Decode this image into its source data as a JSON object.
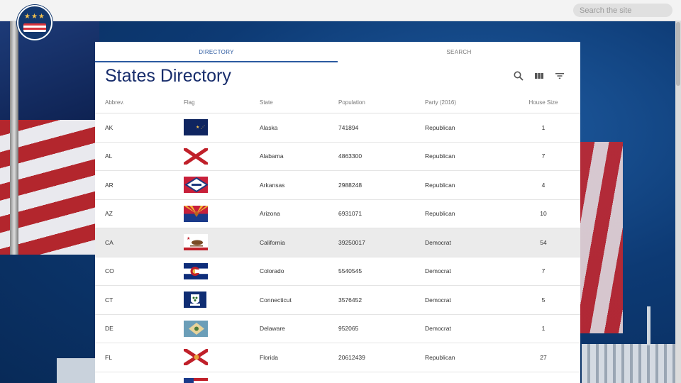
{
  "header": {
    "search_placeholder": "Search the site"
  },
  "tabs": [
    {
      "label": "DIRECTORY",
      "active": true
    },
    {
      "label": "SEARCH",
      "active": false
    }
  ],
  "page_title": "States Directory",
  "toolbar": {
    "icons": [
      "search-icon",
      "columns-icon",
      "filter-icon"
    ]
  },
  "table": {
    "columns": [
      "Abbrev.",
      "Flag",
      "State",
      "Population",
      "Party (2016)",
      "House Size"
    ],
    "rows": [
      {
        "abbr": "AK",
        "flag": "alaska-flag",
        "state": "Alaska",
        "population": "741894",
        "party": "Republican",
        "house": "1"
      },
      {
        "abbr": "AL",
        "flag": "alabama-flag",
        "state": "Alabama",
        "population": "4863300",
        "party": "Republican",
        "house": "7"
      },
      {
        "abbr": "AR",
        "flag": "arkansas-flag",
        "state": "Arkansas",
        "population": "2988248",
        "party": "Republican",
        "house": "4"
      },
      {
        "abbr": "AZ",
        "flag": "arizona-flag",
        "state": "Arizona",
        "population": "6931071",
        "party": "Republican",
        "house": "10"
      },
      {
        "abbr": "CA",
        "flag": "california-flag",
        "state": "California",
        "population": "39250017",
        "party": "Democrat",
        "house": "54",
        "selected": true
      },
      {
        "abbr": "CO",
        "flag": "colorado-flag",
        "state": "Colorado",
        "population": "5540545",
        "party": "Democrat",
        "house": "7"
      },
      {
        "abbr": "CT",
        "flag": "connecticut-flag",
        "state": "Connecticut",
        "population": "3576452",
        "party": "Democrat",
        "house": "5"
      },
      {
        "abbr": "DE",
        "flag": "delaware-flag",
        "state": "Delaware",
        "population": "952065",
        "party": "Democrat",
        "house": "1"
      },
      {
        "abbr": "FL",
        "flag": "florida-flag",
        "state": "Florida",
        "population": "20612439",
        "party": "Republican",
        "house": "27"
      }
    ]
  },
  "colors": {
    "accent": "#2c5aa0",
    "title": "#172c6b",
    "selected_row": "#ebebeb"
  }
}
